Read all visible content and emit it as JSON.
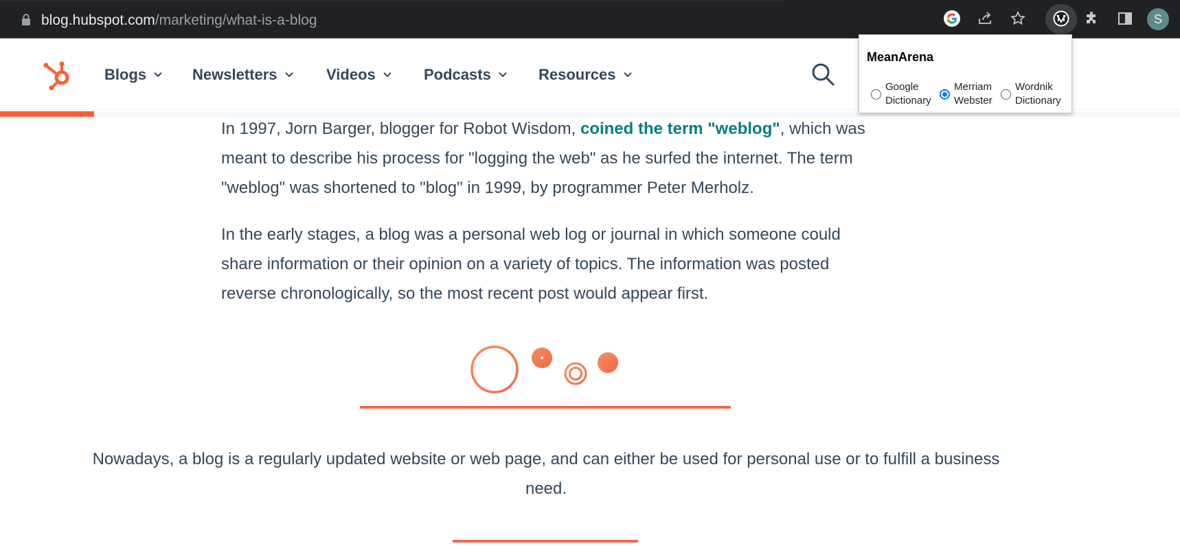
{
  "browser": {
    "url_domain": "blog.hubspot.com",
    "url_path": "/marketing/what-is-a-blog",
    "icons": [
      "lock-icon",
      "google-icon",
      "share-icon",
      "bookmark-star-icon",
      "meanarena-extension-icon",
      "extensions-puzzle-icon",
      "side-panel-icon"
    ],
    "profile_initial": "S"
  },
  "site": {
    "nav": [
      {
        "label": "Blogs"
      },
      {
        "label": "Newsletters"
      },
      {
        "label": "Videos"
      },
      {
        "label": "Podcasts"
      },
      {
        "label": "Resources"
      }
    ],
    "reading_progress": 0.08,
    "brand_color": "#ff5c35"
  },
  "article": {
    "p1_before": "In 1997, Jorn Barger, blogger for Robot Wisdom, ",
    "p1_link": "coined the term \"weblog\"",
    "p1_after": ", which was meant to describe his process for \"logging the web\" as he surfed the internet. The term \"weblog\" was shortened to \"blog\" in 1999, by programmer Peter Merholz.",
    "p2": "In the early stages, a blog was a personal web log or journal in which someone could share information or their opinion on a variety of topics. The information was posted reverse chronologically, so the most recent post would appear first.",
    "p3": "Nowadays, a blog is a regularly updated website or web page, and can either be used for personal use or to fulfill a business need.",
    "accent_color": "#ec6a48"
  },
  "popup": {
    "title": "MeanArena",
    "options": [
      {
        "line1": "Google",
        "line2": "Dictionary",
        "selected": false
      },
      {
        "line1": "Merriam",
        "line2": "Webster",
        "selected": true
      },
      {
        "line1": "Wordnik",
        "line2": "Dictionary",
        "selected": false
      }
    ]
  }
}
